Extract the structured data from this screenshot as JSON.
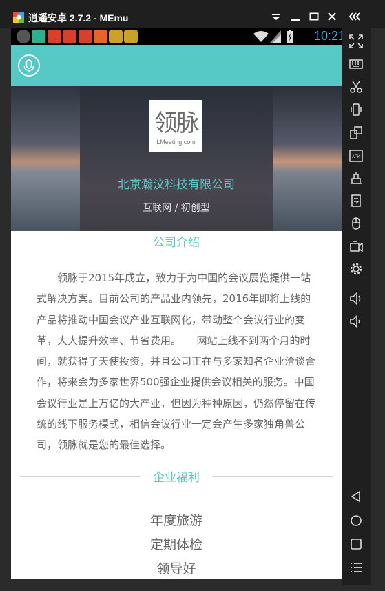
{
  "window": {
    "title": "逍遥安卓 2.7.2 - MEmu"
  },
  "statusbar": {
    "time": "10:21"
  },
  "hero": {
    "logo_text": "领脉",
    "logo_domain": "LMeeting.com",
    "company_name": "北京瀚汶科技有限公司",
    "company_tags": "互联网 / 初创型"
  },
  "intro": {
    "heading": "公司介绍",
    "body": "领脉于2015年成立，致力于为中国的会议展览提供一站式解决方案。目前公司的产品业内领先，2016年即将上线的产品将推动中国会议产业互联网化，带动整个会议行业的变革，大大提升效率、节省费用。　　网站上线不到两个月的时间，就获得了天使投资，并且公司正在与多家知名企业洽谈合作，将来会为多家世界500强企业提供会议相关的服务。中国会议行业是上万亿的大产业，但因为种种原因，仍然停留在传统的线下服务模式，相信会议行业一定会产生多家独角兽公司，领脉就是您的最佳选择。"
  },
  "benefits": {
    "heading": "企业福利",
    "items": [
      "年度旅游",
      "定期体检",
      "领导好"
    ]
  },
  "colors": {
    "accent": "#56c8c6",
    "text": "#666666",
    "emulator_chrome": "#1f1f1f"
  }
}
